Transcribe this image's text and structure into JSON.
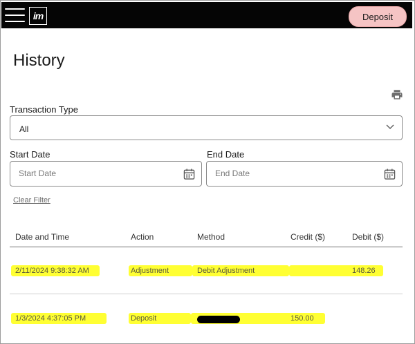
{
  "header": {
    "deposit_label": "Deposit",
    "logo_text": "im"
  },
  "page": {
    "title": "History"
  },
  "filters": {
    "transaction_type_label": "Transaction Type",
    "transaction_type_value": "All",
    "start_date_label": "Start Date",
    "start_date_placeholder": "Start Date",
    "end_date_label": "End Date",
    "end_date_placeholder": "End Date",
    "clear_filter_label": "Clear Filter"
  },
  "table": {
    "columns": [
      "Date and Time",
      "Action",
      "Method",
      "Credit ($)",
      "Debit ($)"
    ],
    "rows": [
      {
        "date": "2/11/2024 9:38:32 AM",
        "action": "Adjustment",
        "method": "Debit Adjustment",
        "credit": "",
        "debit": "148.26"
      },
      {
        "date": "1/3/2024 4:37:05 PM",
        "action": "Deposit",
        "method": "",
        "credit": "150.00",
        "debit": ""
      }
    ]
  },
  "colors": {
    "highlight": "#ffff33",
    "topbar": "#050505",
    "deposit_button": "#f5c4c4"
  }
}
